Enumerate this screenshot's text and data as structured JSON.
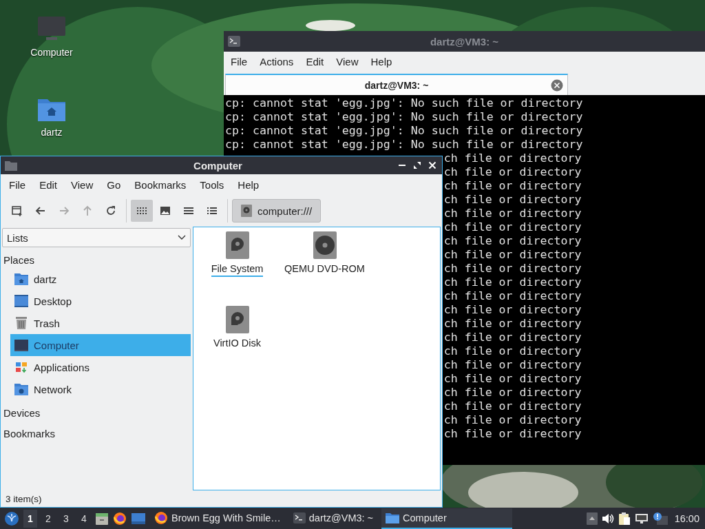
{
  "desktop_icons": [
    {
      "label": "Computer",
      "kind": "computer"
    },
    {
      "label": "dartz",
      "kind": "home"
    }
  ],
  "terminal": {
    "title": "dartz@VM3: ~",
    "menu": [
      "File",
      "Actions",
      "Edit",
      "View",
      "Help"
    ],
    "tab": {
      "label": "dartz@VM3: ~",
      "selected": true
    },
    "lines": [
      {
        "kind": "full",
        "text": "cp: cannot stat 'egg.jpg': No such file or directory"
      },
      {
        "kind": "full",
        "text": "cp: cannot stat 'egg.jpg': No such file or directory"
      },
      {
        "kind": "full",
        "text": "cp: cannot stat 'egg.jpg': No such file or directory"
      },
      {
        "kind": "full",
        "text": "cp: cannot stat 'egg.jpg': No such file or directory"
      },
      {
        "kind": "clipped",
        "text": "ch file or directory"
      },
      {
        "kind": "clipped",
        "text": "ch file or directory"
      },
      {
        "kind": "clipped",
        "text": "ch file or directory"
      },
      {
        "kind": "clipped",
        "text": "ch file or directory"
      },
      {
        "kind": "clipped",
        "text": "ch file or directory"
      },
      {
        "kind": "clipped",
        "text": "ch file or directory"
      },
      {
        "kind": "clipped",
        "text": "ch file or directory"
      },
      {
        "kind": "clipped",
        "text": "ch file or directory"
      },
      {
        "kind": "clipped",
        "text": "ch file or directory"
      },
      {
        "kind": "clipped",
        "text": "ch file or directory"
      },
      {
        "kind": "clipped",
        "text": "ch file or directory"
      },
      {
        "kind": "clipped",
        "text": "ch file or directory"
      },
      {
        "kind": "clipped",
        "text": "ch file or directory"
      },
      {
        "kind": "clipped",
        "text": "ch file or directory"
      },
      {
        "kind": "clipped",
        "text": "ch file or directory"
      },
      {
        "kind": "clipped",
        "text": "ch file or directory"
      },
      {
        "kind": "clipped",
        "text": "ch file or directory"
      },
      {
        "kind": "clipped",
        "text": "ch file or directory"
      },
      {
        "kind": "clipped",
        "text": "ch file or directory"
      },
      {
        "kind": "clipped",
        "text": "ch file or directory"
      },
      {
        "kind": "clipped",
        "text": "ch file or directory"
      }
    ]
  },
  "file_manager": {
    "title": "Computer",
    "menu": [
      "File",
      "Edit",
      "View",
      "Go",
      "Bookmarks",
      "Tools",
      "Help"
    ],
    "nav_buttons": [
      {
        "kind": "new-tab",
        "disabled": false
      },
      {
        "kind": "back",
        "disabled": false
      },
      {
        "kind": "forward",
        "disabled": true
      },
      {
        "kind": "up",
        "disabled": true
      },
      {
        "kind": "reload",
        "disabled": false
      }
    ],
    "view_modes": [
      {
        "kind": "icons",
        "selected": true
      },
      {
        "kind": "thumbnails",
        "selected": false
      },
      {
        "kind": "compact",
        "selected": false
      },
      {
        "kind": "details",
        "selected": false
      }
    ],
    "location": "computer:///",
    "side_pane_mode": "Lists",
    "sidebar": [
      {
        "label": "Places",
        "items": [
          {
            "label": "dartz",
            "kind": "home",
            "selected": false
          },
          {
            "label": "Desktop",
            "kind": "desktop",
            "selected": false
          },
          {
            "label": "Trash",
            "kind": "trash",
            "selected": false
          },
          {
            "label": "Computer",
            "kind": "computer",
            "selected": true
          },
          {
            "label": "Applications",
            "kind": "apps",
            "selected": false
          },
          {
            "label": "Network",
            "kind": "network",
            "selected": false
          }
        ]
      },
      {
        "label": "Devices"
      },
      {
        "label": "Bookmarks"
      }
    ],
    "items": [
      {
        "label": "File System",
        "kind": "disk",
        "focused": true
      },
      {
        "label": "QEMU DVD-ROM",
        "kind": "optical",
        "focused": false
      },
      {
        "label": "VirtIO Disk",
        "kind": "disk",
        "focused": false
      }
    ],
    "status": "3 item(s)"
  },
  "taskbar": {
    "workspaces": [
      {
        "label": "1",
        "selected": true
      },
      {
        "label": "2",
        "selected": false
      },
      {
        "label": "3",
        "selected": false
      },
      {
        "label": "4",
        "selected": false
      }
    ],
    "launchers": [
      {
        "kind": "files"
      },
      {
        "kind": "firefox"
      },
      {
        "kind": "desktop"
      }
    ],
    "tasks": [
      {
        "label": "Brown Egg With Smile…",
        "kind": "firefox",
        "selected": false
      },
      {
        "label": "dartz@VM3: ~",
        "kind": "terminal",
        "selected": false
      },
      {
        "label": "Computer",
        "kind": "folder",
        "selected": true
      }
    ],
    "clock": "16:00"
  }
}
